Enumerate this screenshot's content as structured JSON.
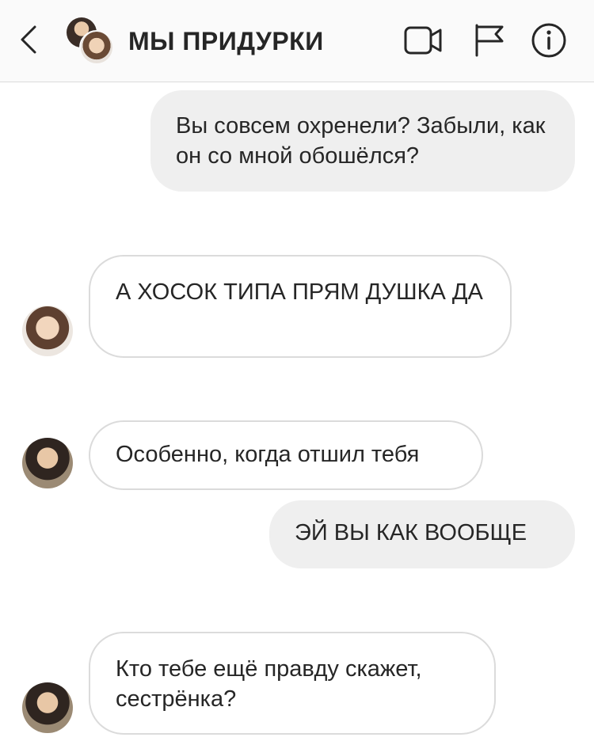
{
  "header": {
    "title": "МЫ ПРИДУРКИ"
  },
  "messages": [
    {
      "direction": "outgoing",
      "text": "Вы совсем охренели? Забыли, как он со мной обошёлся?"
    },
    {
      "direction": "incoming",
      "text": "А ХОСОК ТИПА ПРЯМ ДУШКА ДА"
    },
    {
      "direction": "incoming",
      "text": "Особенно, когда отшил тебя"
    },
    {
      "direction": "outgoing",
      "text": "ЭЙ ВЫ КАК ВООБЩЕ"
    },
    {
      "direction": "incoming",
      "text": "Кто тебе ещё правду скажет, сестрёнка?"
    }
  ],
  "colors": {
    "header_bg": "#fafafa",
    "outgoing_bubble": "#efefef",
    "incoming_border": "#dbdbdb",
    "text": "#262626"
  }
}
